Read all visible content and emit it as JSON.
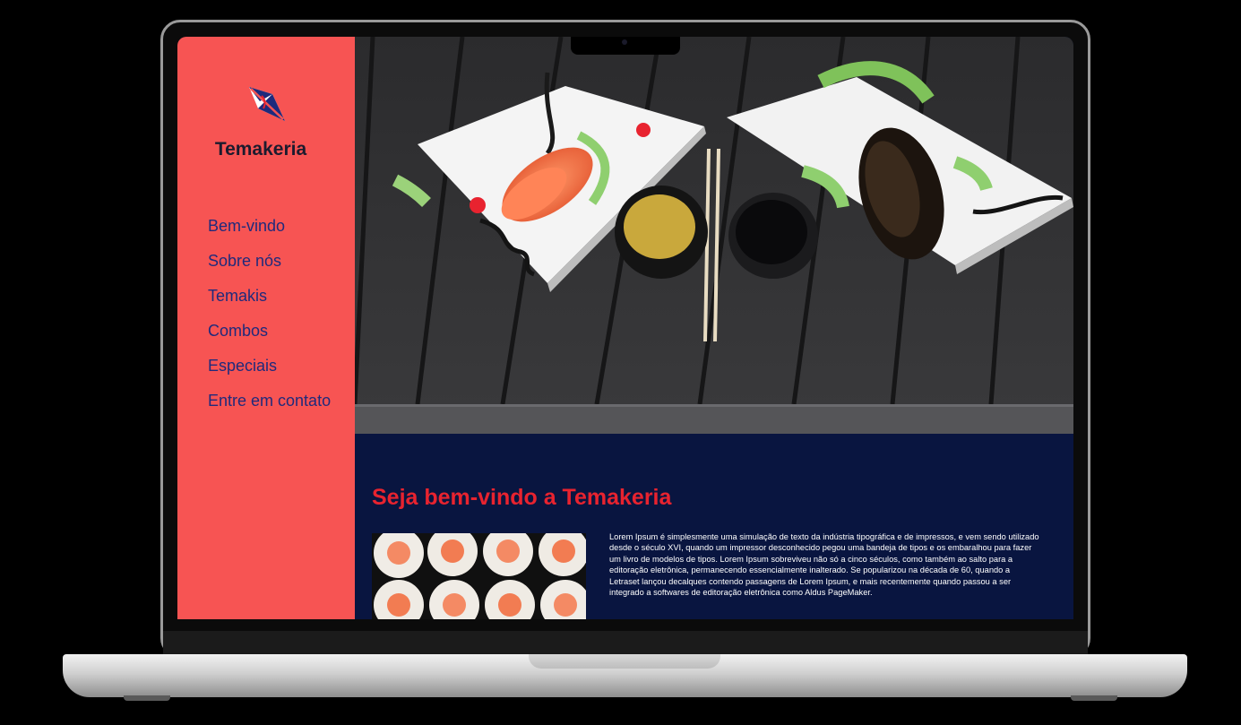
{
  "brand": {
    "name": "Temakeria"
  },
  "nav": [
    {
      "label": "Bem-vindo"
    },
    {
      "label": "Sobre nós"
    },
    {
      "label": "Temakis"
    },
    {
      "label": "Combos"
    },
    {
      "label": "Especiais"
    },
    {
      "label": "Entre em contato"
    }
  ],
  "main": {
    "title": "Seja bem-vindo a Temakeria",
    "body": "Lorem Ipsum é simplesmente uma simulação de texto da indústria tipográfica e de impressos, e vem sendo utilizado desde o século XVI, quando um impressor desconhecido pegou uma bandeja de tipos e os embaralhou para fazer um livro de modelos de tipos. Lorem Ipsum sobreviveu não só a cinco séculos, como também ao salto para a editoração eletrônica, permanecendo essencialmente inalterado. Se popularizou na década de 60, quando a Letraset lançou decalques contendo passagens de Lorem Ipsum, e mais recentemente quando passou a ser integrado a softwares de editoração eletrônica como Aldus PageMaker."
  },
  "colors": {
    "sidebar": "#f75453",
    "nav_text": "#1f2a7c",
    "content_bg": "#091540",
    "title": "#e8232f"
  },
  "icons": {
    "logo": "kite-logo-icon"
  }
}
